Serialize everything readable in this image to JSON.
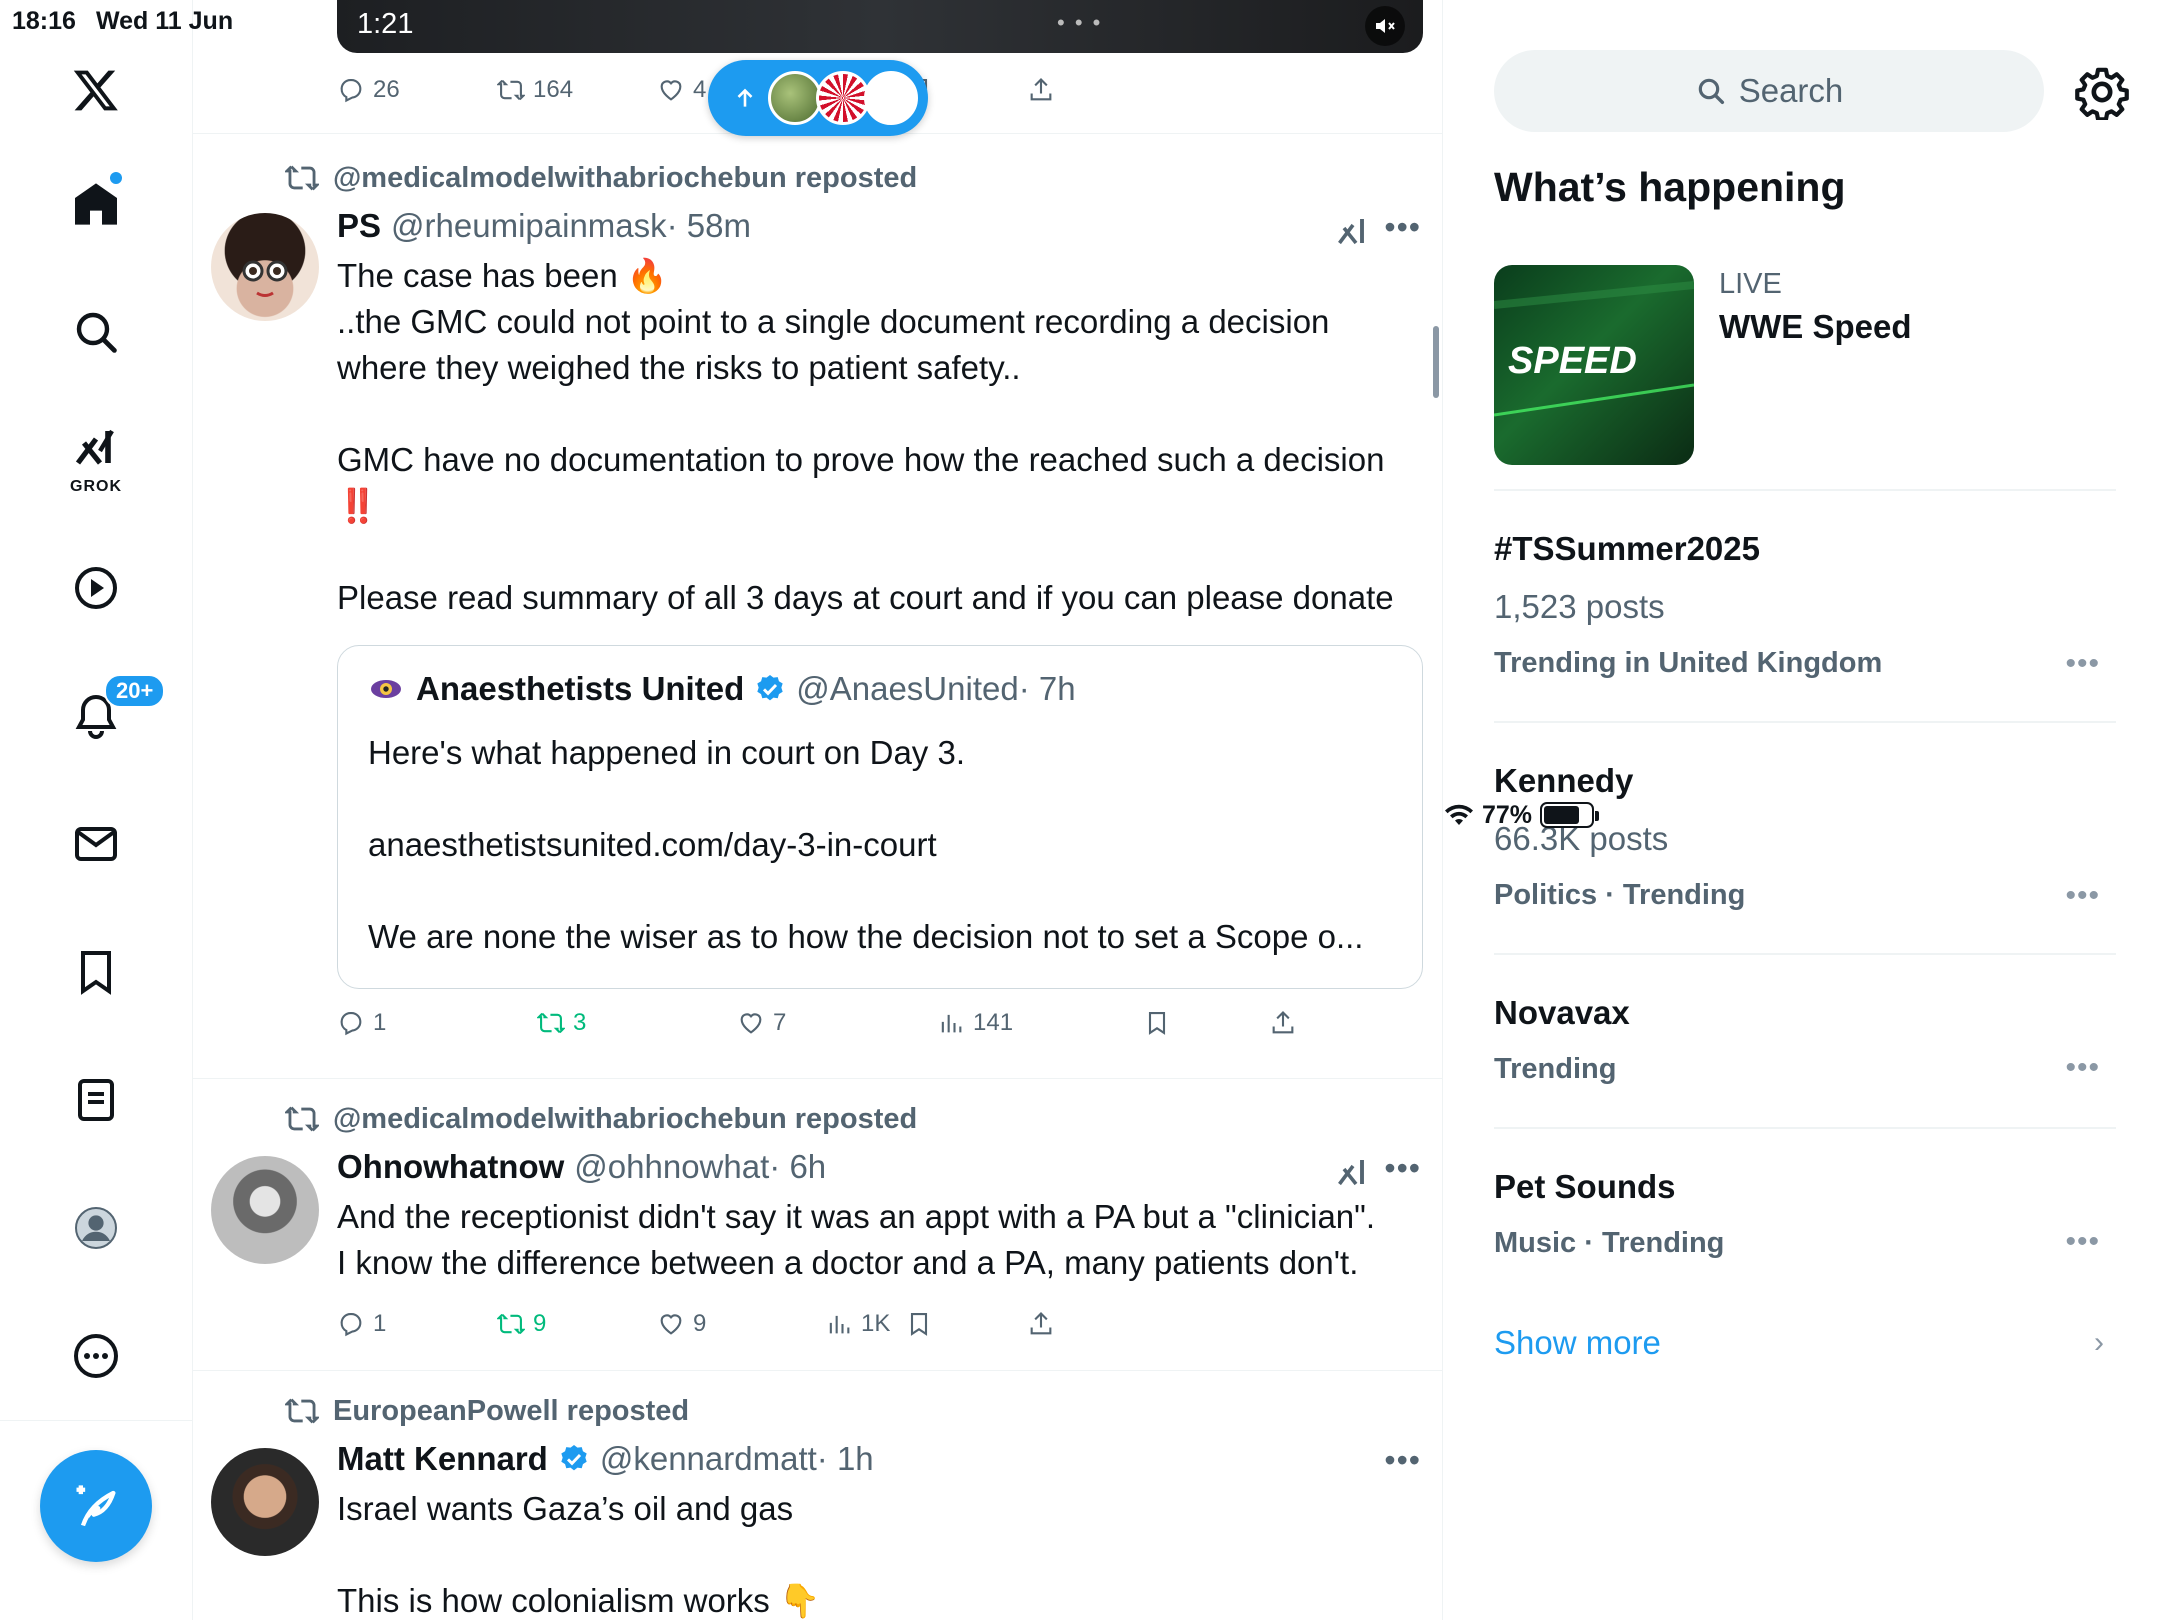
{
  "status": {
    "time": "18:16",
    "date": "Wed 11 Jun",
    "battery": "77%",
    "battery_level": 0.77
  },
  "nav": {
    "notifications_badge": "20+",
    "grok_label": "GROK"
  },
  "top_post": {
    "video_time": "1:21",
    "replies": "26",
    "reposts": "164",
    "likes": "4"
  },
  "posts": [
    {
      "repost_by": "@medicalmodelwithabriochebun reposted",
      "name": "PS",
      "handle": "@rheumipainmask",
      "time": "· 58m",
      "lines": [
        "The case has been 🔥",
        "..the GMC could not point to a single document recording a decision where they weighed the risks to patient safety..",
        "GMC have no documentation to prove how the reached such a decision ‼️",
        "Please read summary of all 3 days at court and if you can please donate"
      ],
      "quote": {
        "name": "Anaesthetists United",
        "handle": "@AnaesUnited",
        "time": "· 7h",
        "l1": "Here's what happened in court on Day 3.",
        "l2": "anaesthetistsunited.com/day-3-in-court",
        "l3": "We are none the wiser as to how the decision not to set a Scope o..."
      },
      "replies": "1",
      "reposts": "3",
      "likes": "7",
      "views": "141"
    },
    {
      "repost_by": "@medicalmodelwithabriochebun reposted",
      "name": "Ohnowhatnow",
      "handle": "@ohhnowhat",
      "time": "· 6h",
      "lines": [
        "And the receptionist didn't say it was an appt with a PA but a \"clinician\".",
        "I know the difference between a doctor and a PA, many patients don't."
      ],
      "replies": "1",
      "reposts": "9",
      "likes": "9",
      "views": "1K"
    },
    {
      "repost_by": "EuropeanPowell reposted",
      "name": "Matt Kennard",
      "handle": "@kennardmatt",
      "time": "· 1h",
      "lines": [
        "Israel wants Gaza’s oil and gas",
        "This is how colonialism works 👇"
      ]
    }
  ],
  "sidebar": {
    "search_placeholder": "Search",
    "whats_happening": "What’s happening",
    "live_label": "LIVE",
    "live_title": "WWE Speed",
    "live_thumb_text": "SPEED",
    "trends": [
      {
        "title": "#TSSummer2025",
        "count": "1,523 posts",
        "meta": "Trending in United Kingdom"
      },
      {
        "title": "Kennedy",
        "count": "66.3K posts",
        "meta": "Politics · Trending"
      },
      {
        "title": "Novavax",
        "count": "",
        "meta": "Trending"
      },
      {
        "title": "Pet Sounds",
        "count": "",
        "meta": "Music · Trending"
      }
    ],
    "show_more": "Show more"
  },
  "colors": {
    "accent": "#1d9bf0",
    "repost_green": "#00ba7c",
    "muted": "#536471"
  }
}
